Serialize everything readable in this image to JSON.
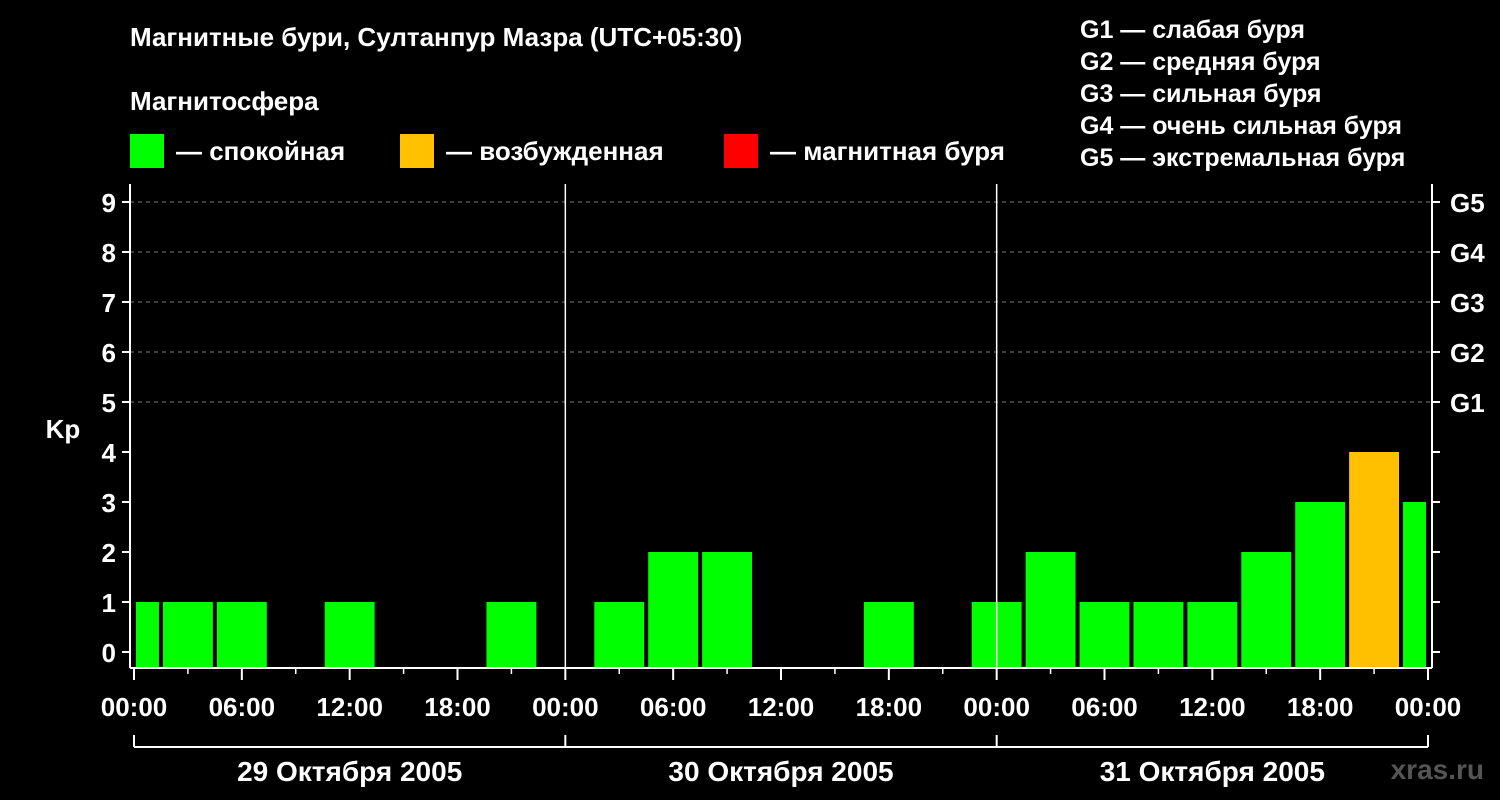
{
  "header": {
    "title": "Магнитные бури, Султанпур Мазра (UTC+05:30)",
    "magnetosphere_label": "Магнитосфера"
  },
  "legend": [
    {
      "label": "— спокойная",
      "color": "#00ff00"
    },
    {
      "label": "— возбужденная",
      "color": "#ffc000"
    },
    {
      "label": "— магнитная буря",
      "color": "#ff0000"
    }
  ],
  "g_legend": [
    "G1 — слабая буря",
    "G2 — средняя буря",
    "G3 — сильная буря",
    "G4 — очень сильная буря",
    "G5 — экстремальная буря"
  ],
  "watermark": "xras.ru",
  "chart_data": {
    "type": "bar",
    "ylabel": "Kp",
    "ylim": [
      0,
      9
    ],
    "yticks": [
      "0",
      "1",
      "2",
      "3",
      "4",
      "5",
      "6",
      "7",
      "8",
      "9"
    ],
    "right_ticks": [
      {
        "kp": 5,
        "label": "G1"
      },
      {
        "kp": 6,
        "label": "G2"
      },
      {
        "kp": 7,
        "label": "G3"
      },
      {
        "kp": 8,
        "label": "G4"
      },
      {
        "kp": 9,
        "label": "G5"
      }
    ],
    "grid": "dashed horizontal at Kp 5–9",
    "x_tick_labels": [
      "00:00",
      "06:00",
      "12:00",
      "18:00",
      "00:00",
      "06:00",
      "12:00",
      "18:00",
      "00:00",
      "06:00",
      "12:00",
      "18:00",
      "00:00"
    ],
    "days": [
      "29 Октября 2005",
      "30 Октября 2005",
      "31 Октября 2005"
    ],
    "colors": {
      "quiet": "#00ff00",
      "unsettled": "#ffc000",
      "storm": "#ff0000"
    },
    "bars": [
      {
        "day": 0,
        "start_hour": 0.0,
        "end_hour": 1.5,
        "kp": 1
      },
      {
        "day": 0,
        "start_hour": 1.5,
        "end_hour": 4.5,
        "kp": 1
      },
      {
        "day": 0,
        "start_hour": 4.5,
        "end_hour": 7.5,
        "kp": 1
      },
      {
        "day": 0,
        "start_hour": 7.5,
        "end_hour": 10.5,
        "kp": 0
      },
      {
        "day": 0,
        "start_hour": 10.5,
        "end_hour": 13.5,
        "kp": 1
      },
      {
        "day": 0,
        "start_hour": 13.5,
        "end_hour": 16.5,
        "kp": 0
      },
      {
        "day": 0,
        "start_hour": 16.5,
        "end_hour": 19.5,
        "kp": 0
      },
      {
        "day": 0,
        "start_hour": 19.5,
        "end_hour": 22.5,
        "kp": 1
      },
      {
        "day": 0,
        "start_hour": 22.5,
        "end_hour": 25.5,
        "kp": 0
      },
      {
        "day": 0,
        "start_hour": 25.5,
        "end_hour": 28.5,
        "kp": 1
      },
      {
        "day": 0,
        "start_hour": 28.5,
        "end_hour": 31.5,
        "kp": 2
      },
      {
        "day": 0,
        "start_hour": 31.5,
        "end_hour": 34.5,
        "kp": 2
      },
      {
        "day": 0,
        "start_hour": 34.5,
        "end_hour": 37.5,
        "kp": 0
      },
      {
        "day": 0,
        "start_hour": 37.5,
        "end_hour": 40.5,
        "kp": 0
      },
      {
        "day": 0,
        "start_hour": 40.5,
        "end_hour": 43.5,
        "kp": 1
      },
      {
        "day": 0,
        "start_hour": 43.5,
        "end_hour": 46.5,
        "kp": 0
      },
      {
        "day": 0,
        "start_hour": 46.5,
        "end_hour": 49.5,
        "kp": 1
      },
      {
        "day": 0,
        "start_hour": 49.5,
        "end_hour": 52.5,
        "kp": 2
      },
      {
        "day": 0,
        "start_hour": 52.5,
        "end_hour": 55.5,
        "kp": 1
      },
      {
        "day": 0,
        "start_hour": 55.5,
        "end_hour": 58.5,
        "kp": 1
      },
      {
        "day": 0,
        "start_hour": 58.5,
        "end_hour": 61.5,
        "kp": 1
      },
      {
        "day": 0,
        "start_hour": 61.5,
        "end_hour": 64.5,
        "kp": 2
      },
      {
        "day": 0,
        "start_hour": 64.5,
        "end_hour": 67.5,
        "kp": 3
      },
      {
        "day": 0,
        "start_hour": 67.5,
        "end_hour": 70.5,
        "kp": 4
      },
      {
        "day": 0,
        "start_hour": 70.5,
        "end_hour": 72.0,
        "kp": 3
      }
    ]
  }
}
